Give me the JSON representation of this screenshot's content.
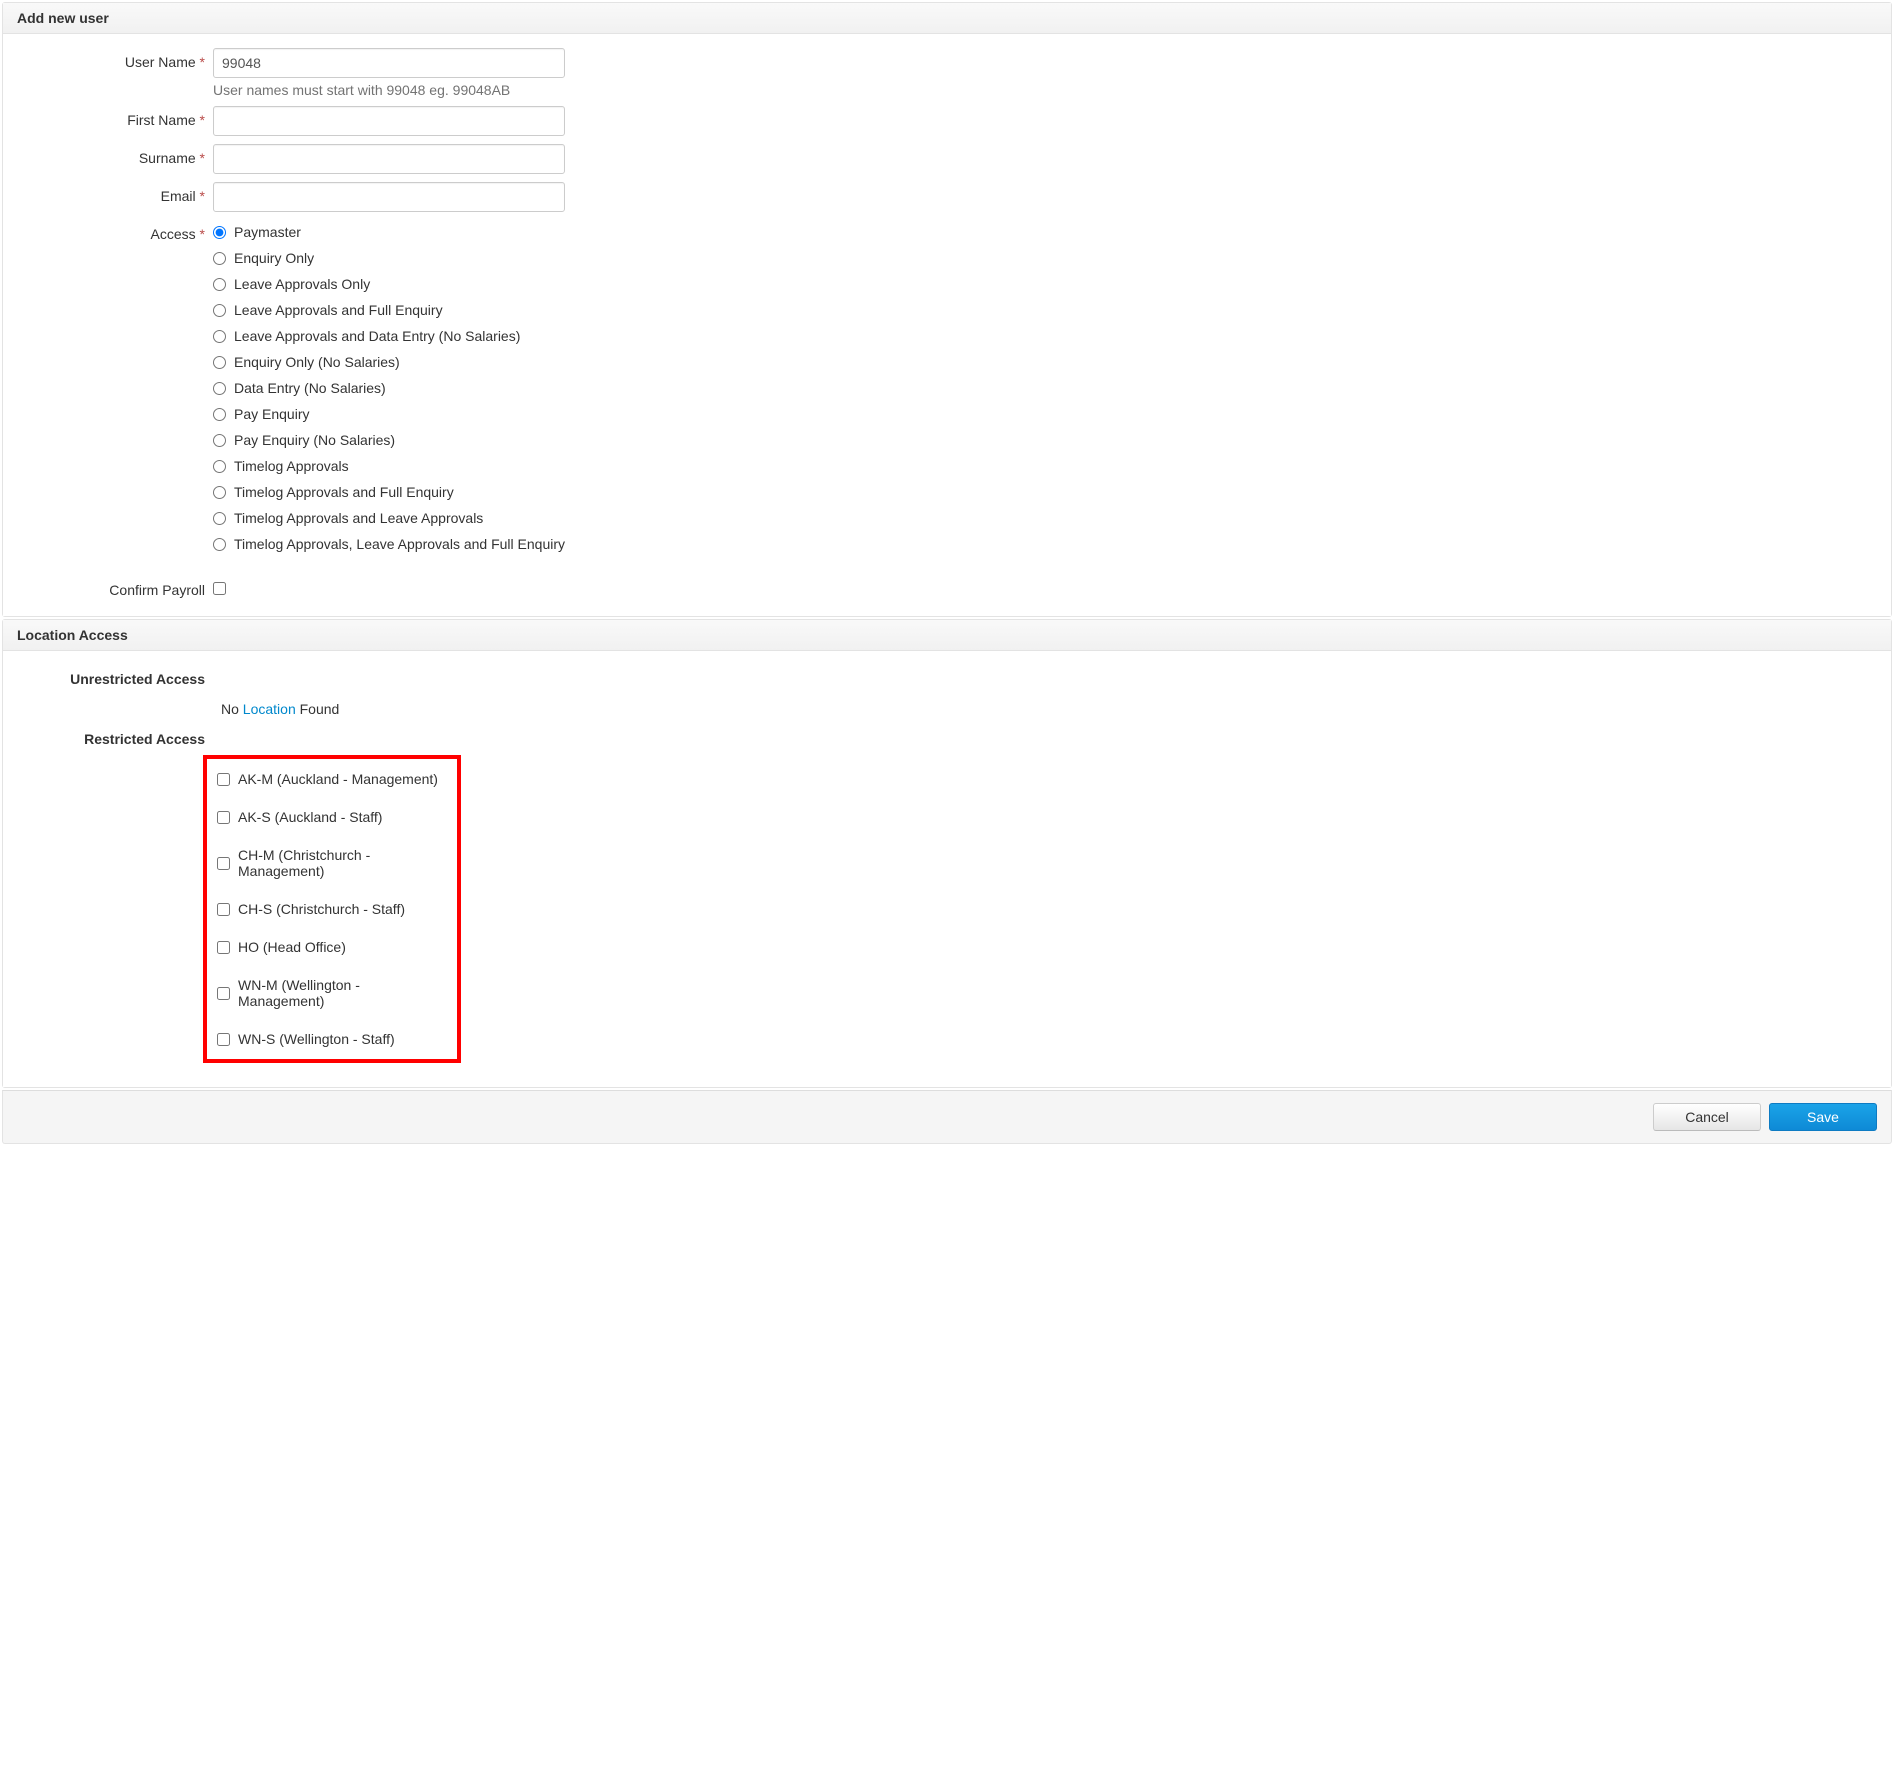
{
  "sections": {
    "addUser": {
      "title": "Add new user",
      "fields": {
        "username": {
          "label": "User Name",
          "required": "*",
          "value": "99048",
          "help": "User names must start with 99048 eg. 99048AB"
        },
        "firstName": {
          "label": "First Name",
          "required": "*",
          "value": ""
        },
        "surname": {
          "label": "Surname",
          "required": "*",
          "value": ""
        },
        "email": {
          "label": "Email",
          "required": "*",
          "value": ""
        },
        "access": {
          "label": "Access",
          "required": "*"
        },
        "confirmPayroll": {
          "label": "Confirm Payroll"
        }
      },
      "accessOptions": [
        "Paymaster",
        "Enquiry Only",
        "Leave Approvals Only",
        "Leave Approvals and Full Enquiry",
        "Leave Approvals and Data Entry (No Salaries)",
        "Enquiry Only (No Salaries)",
        "Data Entry (No Salaries)",
        "Pay Enquiry",
        "Pay Enquiry (No Salaries)",
        "Timelog Approvals",
        "Timelog Approvals and Full Enquiry",
        "Timelog Approvals and Leave Approvals",
        "Timelog Approvals, Leave Approvals and Full Enquiry"
      ],
      "accessSelected": 0
    },
    "locationAccess": {
      "title": "Location Access",
      "unrestrictedLabel": "Unrestricted Access",
      "noLocationPrefix": "No ",
      "noLocationLink": "Location",
      "noLocationSuffix": " Found",
      "restrictedLabel": "Restricted Access",
      "restrictedOptions": [
        "AK-M (Auckland - Management)",
        "AK-S (Auckland - Staff)",
        "CH-M (Christchurch - Management)",
        "CH-S (Christchurch - Staff)",
        "HO (Head Office)",
        "WN-M (Wellington - Management)",
        "WN-S (Wellington - Staff)"
      ]
    }
  },
  "footer": {
    "cancel": "Cancel",
    "save": "Save"
  }
}
